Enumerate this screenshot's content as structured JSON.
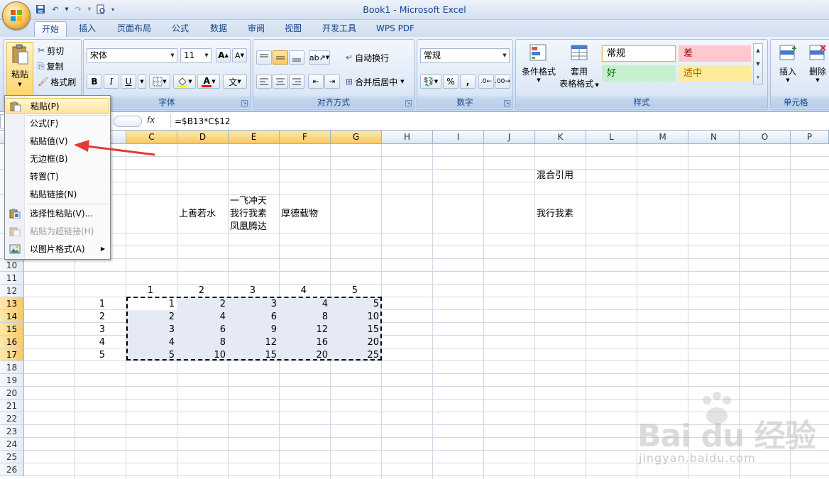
{
  "window": {
    "title": "Book1 - Microsoft Excel"
  },
  "tabs": [
    "开始",
    "插入",
    "页面布局",
    "公式",
    "数据",
    "审阅",
    "视图",
    "开发工具",
    "WPS PDF"
  ],
  "ribbon": {
    "clipboard": {
      "paste": "粘贴",
      "cut": "剪切",
      "copy": "复制",
      "format_painter": "格式刷"
    },
    "font": {
      "name": "宋体",
      "size": "11",
      "label": "字体",
      "bold": "B",
      "italic": "I",
      "underline": "U",
      "grow": "A",
      "shrink": "A",
      "font_color": "A",
      "phonetic": "文"
    },
    "alignment": {
      "wrap": "自动换行",
      "merge": "合并后居中",
      "label": "对齐方式"
    },
    "number": {
      "format": "常规",
      "percent": "%",
      "comma": ",",
      "label": "数字"
    },
    "styles": {
      "cond_format": "条件格式",
      "table_format_1": "套用",
      "table_format_2": "表格格式",
      "normal": "常规",
      "bad": "差",
      "good": "好",
      "neutral": "适中",
      "label": "样式"
    },
    "cells": {
      "insert": "插入",
      "delete": "删除",
      "label": "单元格"
    }
  },
  "formula_bar": {
    "fx": "fx",
    "formula": "=$B13*C$12"
  },
  "paste_menu": {
    "items": [
      "粘贴(P)",
      "公式(F)",
      "粘贴值(V)",
      "无边框(B)",
      "转置(T)",
      "粘贴链接(N)",
      "选择性粘贴(V)...",
      "粘贴为超链接(H)",
      "以图片格式(A)"
    ]
  },
  "columns": [
    "C",
    "D",
    "E",
    "F",
    "G",
    "H",
    "I",
    "J",
    "K",
    "L",
    "M",
    "N",
    "O",
    "P"
  ],
  "rows": [
    "10",
    "11",
    "12",
    "13",
    "14",
    "15",
    "16",
    "17",
    "18",
    "19",
    "20",
    "21",
    "22",
    "23",
    "24",
    "25",
    "26"
  ],
  "sheet": {
    "k_mixed": "混合引用",
    "d_text": "上善若水",
    "e_line1": "一飞冲天",
    "e_line2": "我行我素",
    "e_line3": "凤凰腾达",
    "f_text": "厚德载物",
    "k_text": "我行我素",
    "header_row": [
      "1",
      "2",
      "3",
      "4",
      "5"
    ],
    "row_labels": [
      "1",
      "2",
      "3",
      "4",
      "5"
    ],
    "table": [
      [
        "1",
        "2",
        "3",
        "4",
        "5"
      ],
      [
        "2",
        "4",
        "6",
        "8",
        "10"
      ],
      [
        "3",
        "6",
        "9",
        "12",
        "15"
      ],
      [
        "4",
        "8",
        "12",
        "16",
        "20"
      ],
      [
        "5",
        "10",
        "15",
        "20",
        "25"
      ]
    ]
  },
  "watermark": {
    "text": "Bai du 经验",
    "url": "jingyan.baidu.com"
  }
}
